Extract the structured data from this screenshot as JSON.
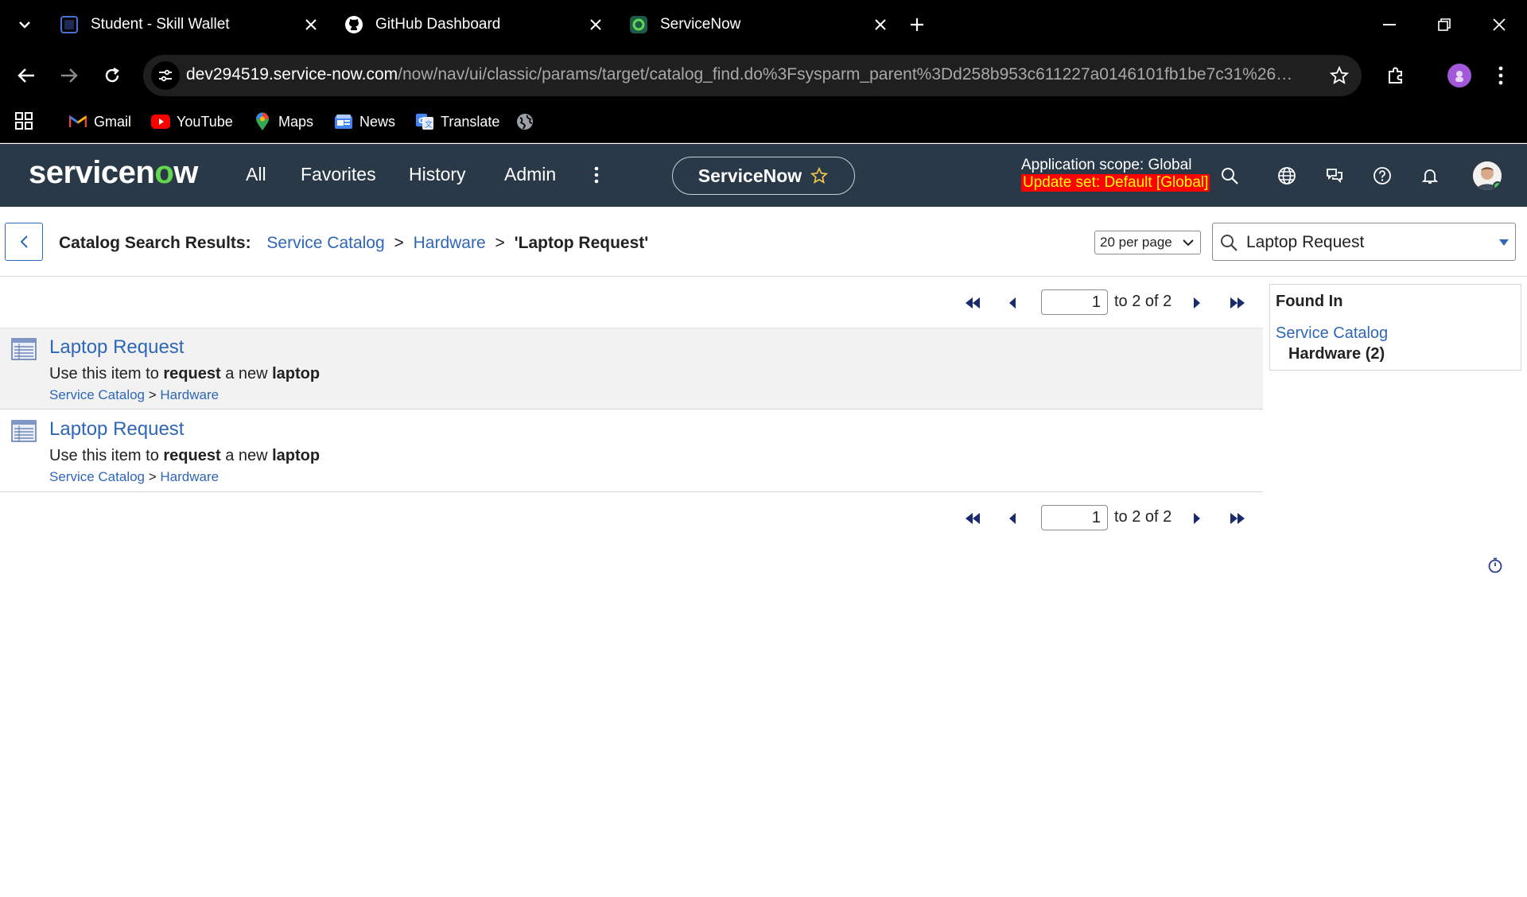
{
  "browser": {
    "tabs": [
      {
        "title": "Student - Skill Wallet",
        "icon": "skill-wallet-icon"
      },
      {
        "title": "GitHub Dashboard",
        "icon": "github-icon"
      },
      {
        "title": "ServiceNow",
        "icon": "servicenow-icon"
      }
    ],
    "url_host": "dev294519.service-now.com",
    "url_path": "/now/nav/ui/classic/params/target/catalog_find.do%3Fsysparm_parent%3Dd258b953c611227a0146101fb1be7c31%26sys...",
    "bookmarks": [
      {
        "label": "Gmail",
        "icon": "gmail-icon"
      },
      {
        "label": "YouTube",
        "icon": "youtube-icon"
      },
      {
        "label": "Maps",
        "icon": "maps-icon"
      },
      {
        "label": "News",
        "icon": "news-icon"
      },
      {
        "label": "Translate",
        "icon": "translate-icon"
      }
    ]
  },
  "header": {
    "logo_pre": "servicen",
    "logo_o": "o",
    "logo_post": "w",
    "menu": [
      "All",
      "Favorites",
      "History",
      "Admin"
    ],
    "pill_label": "ServiceNow",
    "app_scope": "Application scope: Global",
    "update_set": "Update set: Default [Global]",
    "colors": {
      "header_bg": "#2a3947",
      "logo_accent": "#62d84e",
      "update_set_bg": "#ff0000",
      "update_set_fg": "#ffff00",
      "link": "#2e66b8"
    }
  },
  "titlebar": {
    "label": "Catalog Search Results:",
    "crumb1": "Service Catalog",
    "crumb2": "Hardware",
    "sep": ">",
    "current": "'Laptop Request'",
    "per_page": "20 per page",
    "search_value": "Laptop Request"
  },
  "pager": {
    "page": "1",
    "range_text": "to 2 of 2"
  },
  "results": [
    {
      "title": "Laptop Request",
      "desc_pre": "Use this item to ",
      "desc_b1": "request",
      "desc_mid": " a new ",
      "desc_b2": "laptop",
      "path1": "Service Catalog",
      "path_sep": " > ",
      "path2": "Hardware"
    },
    {
      "title": "Laptop Request",
      "desc_pre": "Use this item to ",
      "desc_b1": "request",
      "desc_mid": " a new ",
      "desc_b2": "laptop",
      "path1": "Service Catalog",
      "path_sep": " > ",
      "path2": "Hardware"
    }
  ],
  "found_in": {
    "heading": "Found In",
    "link": "Service Catalog",
    "sub": "Hardware (2)"
  }
}
